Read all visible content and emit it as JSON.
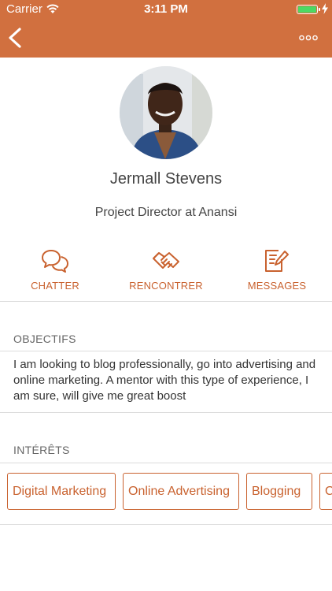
{
  "status_bar": {
    "carrier": "Carrier",
    "time": "3:11 PM"
  },
  "nav": {
    "back_icon": "chevron-left-icon",
    "more_icon": "ellipsis-icon"
  },
  "profile": {
    "name": "Jermall Stevens",
    "title": "Project Director at Anansi"
  },
  "actions": [
    {
      "label": "CHATTER",
      "icon": "chat-bubbles-icon"
    },
    {
      "label": "RENCONTRER",
      "icon": "handshake-icon"
    },
    {
      "label": "MESSAGES",
      "icon": "compose-note-icon"
    }
  ],
  "objectives": {
    "heading": "OBJECTIFS",
    "text": "I am looking to blog professionally, go into advertising and online marketing. A mentor with this type of experience, I am sure, will give me great boost"
  },
  "interests": {
    "heading": "INTÉRÊTS",
    "items": [
      "Digital Marketing",
      "Online Advertising",
      "Blogging",
      "C"
    ]
  },
  "colors": {
    "accent": "#d1703f",
    "accent_text": "#c9622f",
    "battery": "#4cd964"
  }
}
